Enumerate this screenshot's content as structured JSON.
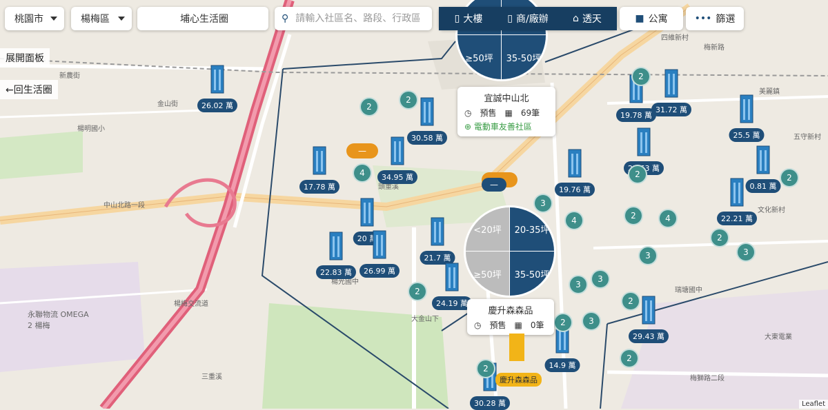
{
  "filters": {
    "city": "桃園市",
    "district": "楊梅區",
    "area": "埔心生活圈",
    "search_placeholder": "請輸入社區名、路段、行政區"
  },
  "building_types": [
    {
      "label": "大樓",
      "icon": "tower-icon",
      "active": true
    },
    {
      "label": "商/廠辦",
      "icon": "office-icon",
      "active": true
    },
    {
      "label": "透天",
      "icon": "house-icon",
      "active": true
    }
  ],
  "apartment_label": "公寓",
  "filter_label": "篩選",
  "panel": {
    "expand": "展開面板",
    "back": "←回生活圈"
  },
  "colors": {
    "primary": "#1f4e78",
    "cluster": "#3e8f8a",
    "accent_orange": "#e8951c",
    "ev_green": "#3a9d46",
    "highway": "#e0607a",
    "boundary": "#2a4a6a"
  },
  "price_pills": [
    "26.02 萬",
    "30.58 萬",
    "34.95 萬",
    "17.78 萬",
    "20 萬",
    "26.99 萬",
    "22.83 萬",
    "21.7 萬",
    "24.19 萬",
    "19.78 萬",
    "31.72 萬",
    "25.5 萬",
    "27.63 萬",
    "19.76 萬",
    "0.81 萬",
    "22.21 萬",
    "29.43 萬",
    "14.9 萬",
    "30.28 萬"
  ],
  "clusters": [
    "2",
    "2",
    "4",
    "2",
    "3",
    "4",
    "4",
    "3",
    "2",
    "2",
    "2",
    "3",
    "2",
    "3",
    "3",
    "3",
    "2",
    "2",
    "2",
    "2",
    "2"
  ],
  "popup_top": {
    "title": "宜誠中山北",
    "status": "預售",
    "count": "69筆",
    "ev": "電動車友善社區"
  },
  "popup_bottom": {
    "title": "慶升森森品",
    "status": "預售",
    "count": "0筆",
    "tag": "慶升森森品"
  },
  "pie_top": [
    "≥50坪",
    "35-50坪"
  ],
  "pie_mid": [
    "<20坪",
    "20-35坪",
    "≥50坪",
    "35-50坪"
  ],
  "map_labels": [
    "楊梅交流道",
    "新農街",
    "金山街",
    "中山北路一段",
    "頭重溪",
    "楊光國中",
    "大金山下",
    "三重溪",
    "永聯物流 OMEGA 2 楊梅",
    "楊明國小",
    "四維新村",
    "文化新村",
    "瑞塘國中",
    "大東電業",
    "梅獅路二段",
    "五守新村",
    "美麗鎮",
    "梅新路"
  ],
  "attribution": "Leaflet"
}
